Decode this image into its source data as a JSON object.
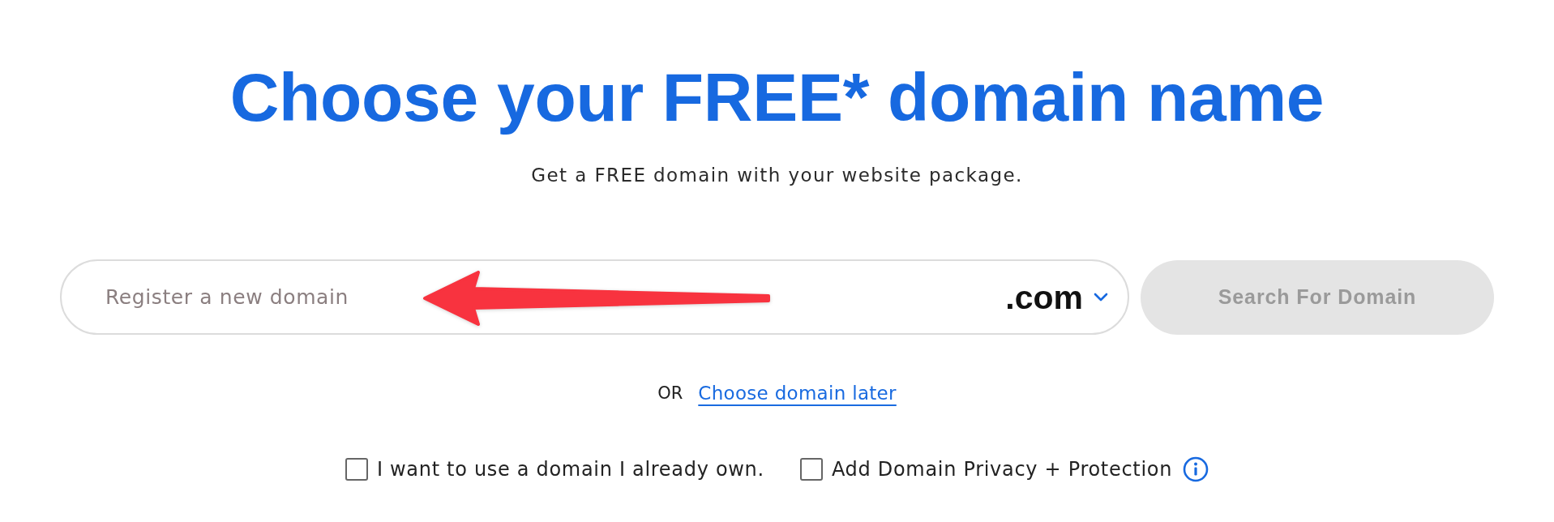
{
  "heading": {
    "title": "Choose your FREE* domain name",
    "subtitle": "Get a FREE domain with your website package."
  },
  "search": {
    "placeholder": "Register a new domain",
    "tld": ".com",
    "button": {
      "label": "Search For Domain",
      "disabled": true
    }
  },
  "alternative": {
    "prefix": "OR",
    "link": "Choose domain later"
  },
  "options": [
    {
      "label": "I want to use a domain I already own.",
      "checked": false,
      "info": false
    },
    {
      "label": "Add Domain Privacy + Protection",
      "checked": false,
      "info": true
    }
  ]
}
